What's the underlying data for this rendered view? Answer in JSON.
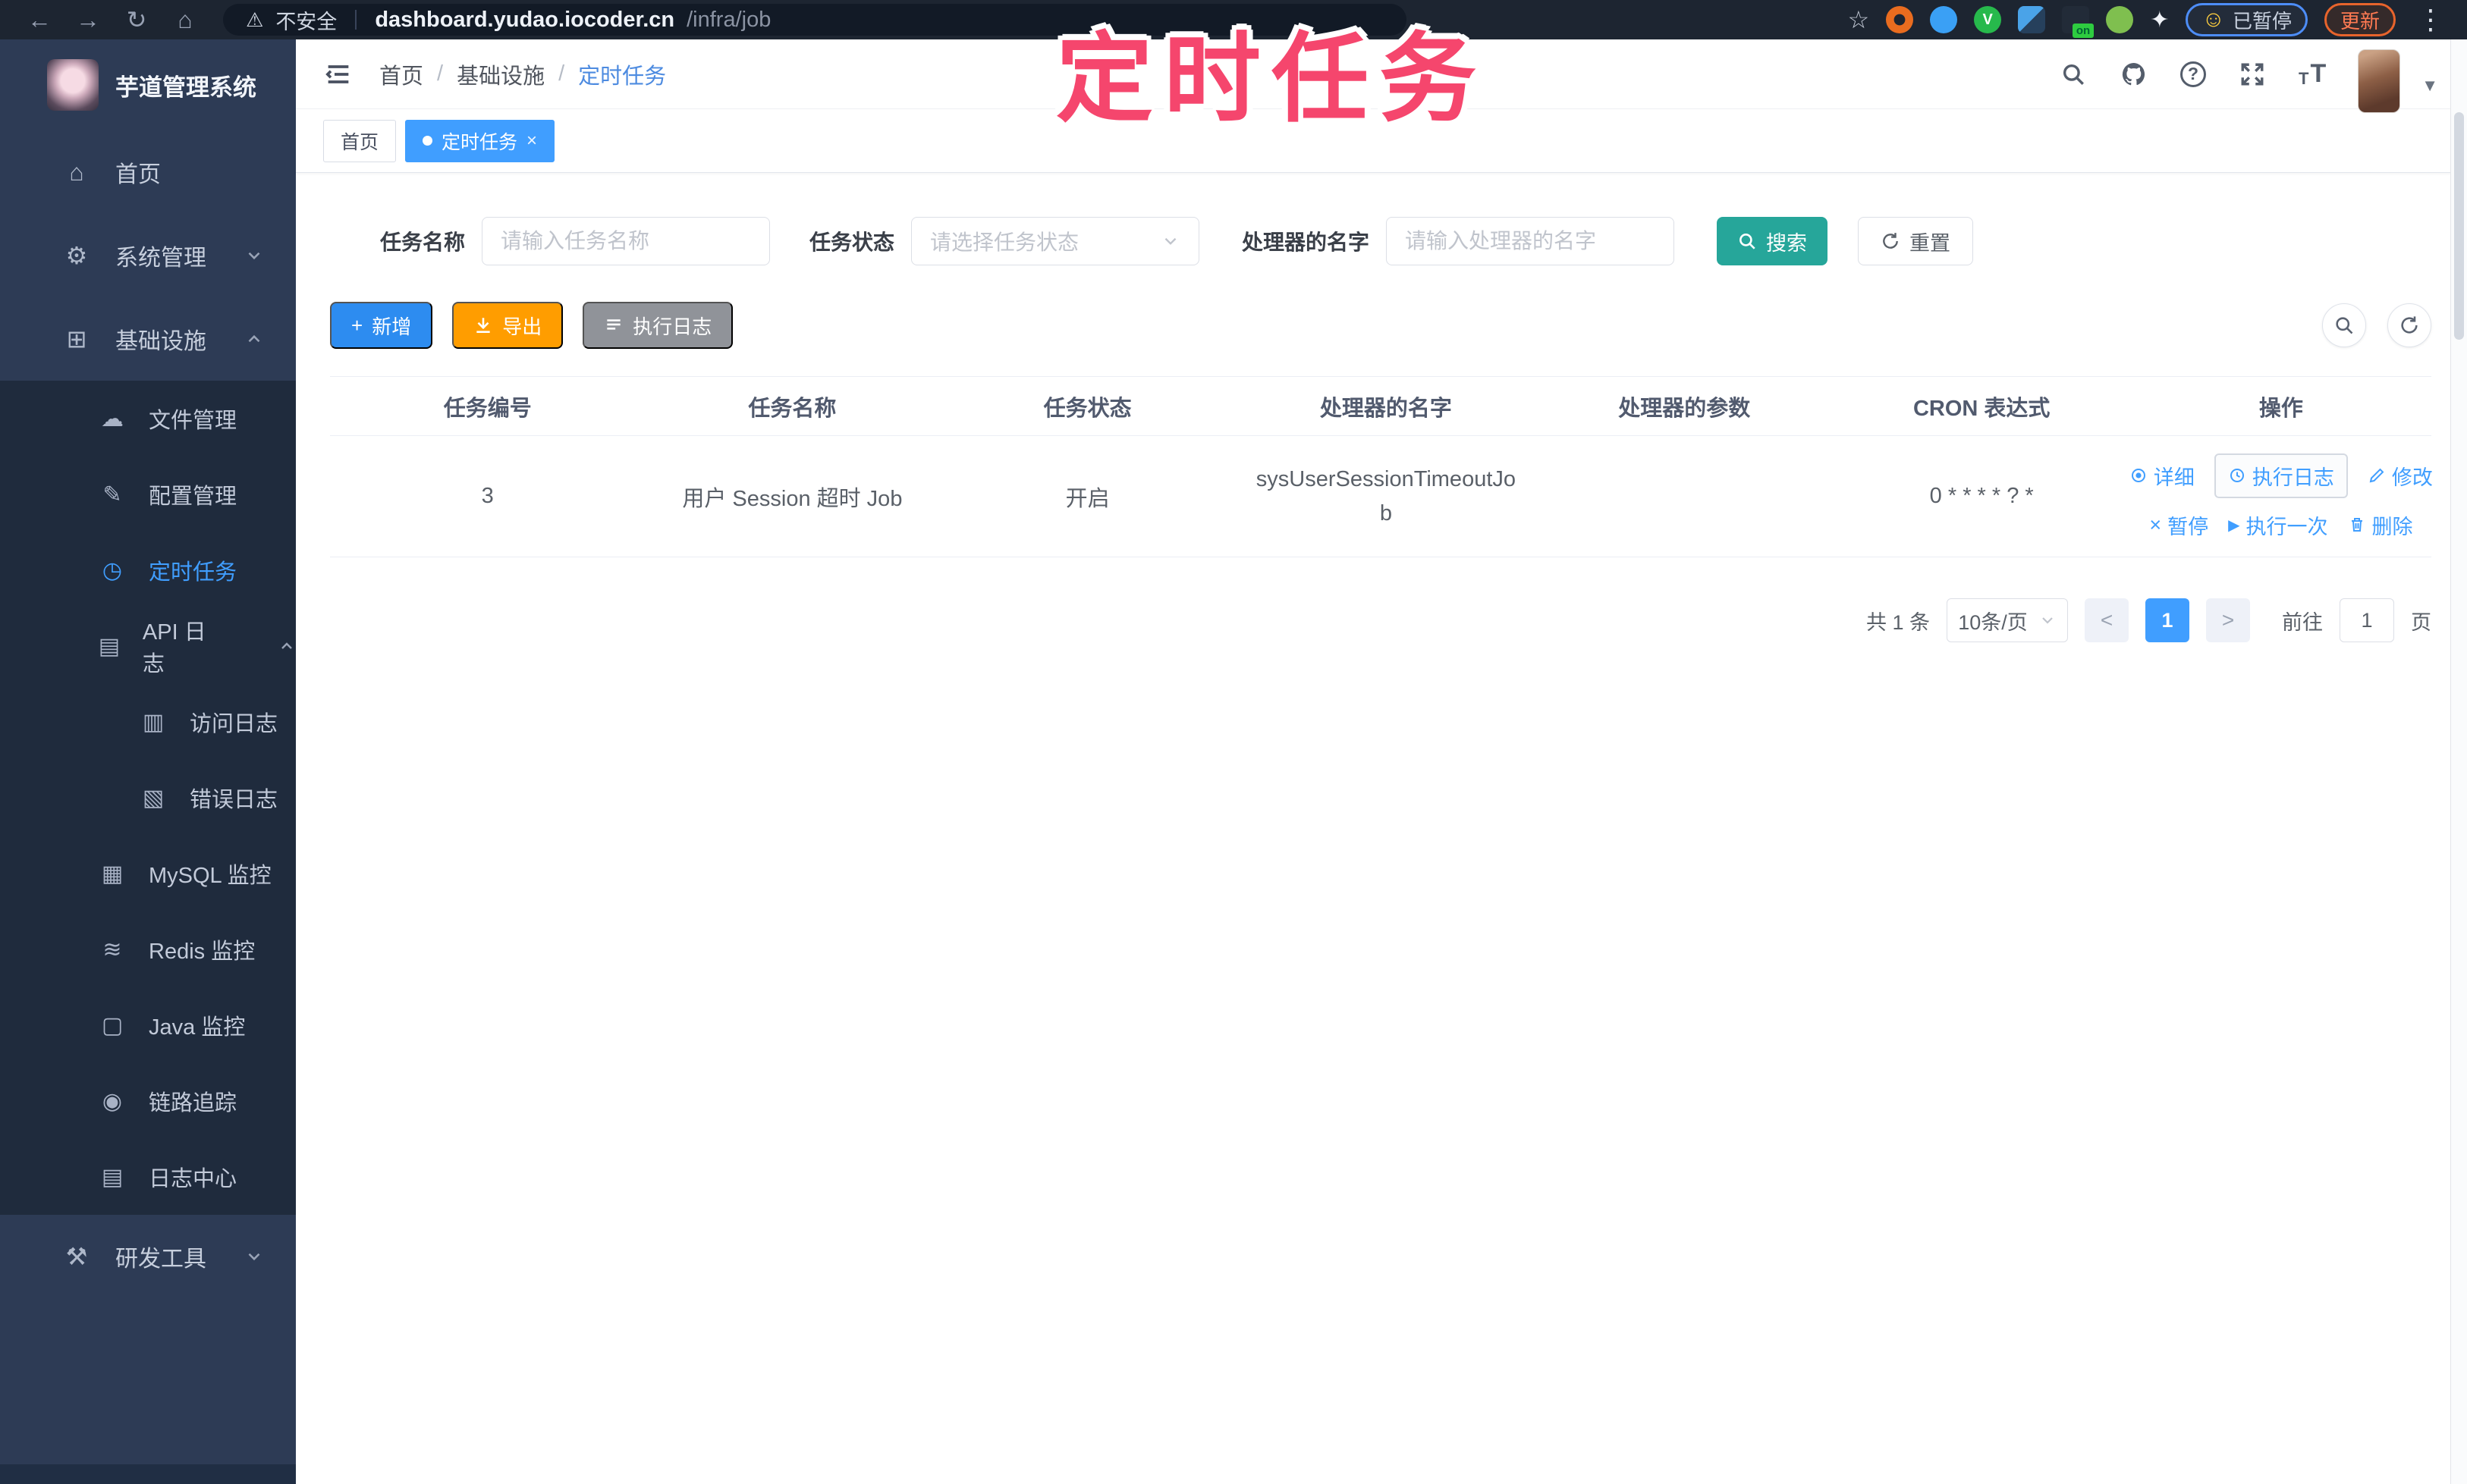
{
  "colors": {
    "primary": "#409eff",
    "search_teal": "#26a69a",
    "export_orange": "#ff9d00",
    "exec_gray": "#909399",
    "annotation_pink": "#f5466d"
  },
  "annotation": {
    "text": "定时任务"
  },
  "browser": {
    "security_label": "不安全",
    "url_host": "dashboard.yudao.iocoder.cn",
    "url_path": "/infra/job",
    "ext_on_badge": "on",
    "ext_green_glyph": "V",
    "paused_chip": "已暂停",
    "paused_emoji": "☺",
    "update_chip": "更新",
    "kebab": "⋮",
    "back": "←",
    "forward": "→",
    "reload": "↻",
    "home": "⌂",
    "warning": "⚠",
    "star": "☆"
  },
  "sidebar": {
    "title": "芋道管理系统",
    "items": [
      {
        "label": "首页",
        "glyph": "⌂"
      },
      {
        "label": "系统管理",
        "glyph": "⚙"
      },
      {
        "label": "基础设施",
        "glyph": "⊞"
      },
      {
        "label": "文件管理",
        "glyph": "☁"
      },
      {
        "label": "配置管理",
        "glyph": "✎"
      },
      {
        "label": "定时任务",
        "glyph": "◷"
      },
      {
        "label": "API 日志",
        "glyph": "▤"
      },
      {
        "label": "访问日志",
        "glyph": "▥"
      },
      {
        "label": "错误日志",
        "glyph": "▧"
      },
      {
        "label": "MySQL 监控",
        "glyph": "▦"
      },
      {
        "label": "Redis 监控",
        "glyph": "≋"
      },
      {
        "label": "Java 监控",
        "glyph": "▢"
      },
      {
        "label": "链路追踪",
        "glyph": "◉"
      },
      {
        "label": "日志中心",
        "glyph": "▤"
      },
      {
        "label": "研发工具",
        "glyph": "⚒"
      }
    ]
  },
  "header": {
    "breadcrumb": {
      "items": [
        "首页",
        "基础设施",
        "定时任务"
      ],
      "separator": "/"
    },
    "help_glyph": "?",
    "caret": "▼",
    "tt_small": "T",
    "tt_big": "T"
  },
  "tabs": [
    {
      "label": "首页"
    },
    {
      "label": "定时任务",
      "close": "×"
    }
  ],
  "filters": {
    "name_label": "任务名称",
    "name_placeholder": "请输入任务名称",
    "status_label": "任务状态",
    "status_placeholder": "请选择任务状态",
    "handler_label": "处理器的名字",
    "handler_placeholder": "请输入处理器的名字",
    "search_label": "搜索",
    "reset_label": "重置"
  },
  "toolbar": {
    "add_label": "新增",
    "add_plus": "+",
    "export_label": "导出",
    "exec_log_label": "执行日志"
  },
  "table": {
    "columns": [
      "任务编号",
      "任务名称",
      "任务状态",
      "处理器的名字",
      "处理器的参数",
      "CRON 表达式",
      "操作"
    ],
    "row": {
      "id": "3",
      "name": "用户 Session 超时 Job",
      "status": "开启",
      "handler": "sysUserSessionTimeoutJob",
      "param": "",
      "cron": "0 * * * * ? *"
    },
    "actions": {
      "detail": "详细",
      "exec_log": "执行日志",
      "edit": "修改",
      "pause": "暂停",
      "pause_glyph": "×",
      "run_once": "执行一次",
      "run_glyph": "▶",
      "delete": "删除"
    }
  },
  "pagination": {
    "total": "共 1 条",
    "page_size": "10条/页",
    "prev": "<",
    "next": ">",
    "page": "1",
    "goto_label": "前往",
    "goto_value": "1",
    "page_suffix": "页"
  }
}
